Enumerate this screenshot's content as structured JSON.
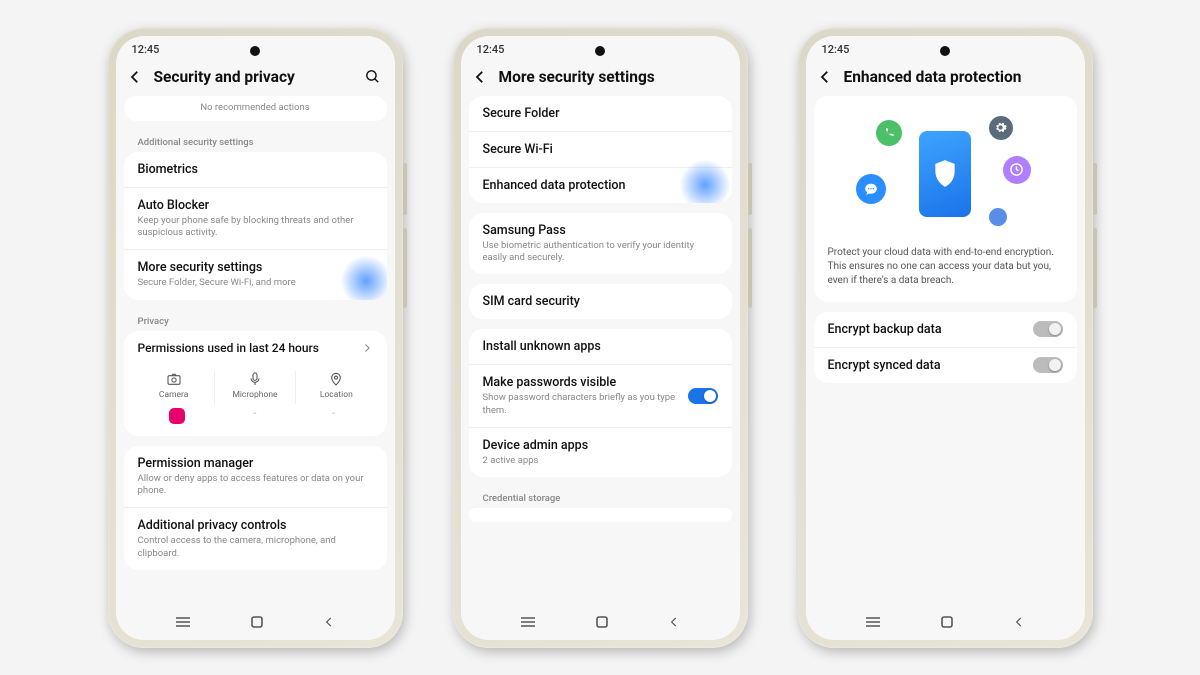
{
  "statusTime": "12:45",
  "screen1": {
    "title": "Security and privacy",
    "noActions": "No recommended actions",
    "section1": "Additional security settings",
    "biometrics": "Biometrics",
    "autoBlocker": {
      "label": "Auto Blocker",
      "sub": "Keep your phone safe by blocking threats and other suspicious activity."
    },
    "moreSecurity": {
      "label": "More security settings",
      "sub": "Secure Folder, Secure Wi-Fi, and more"
    },
    "section2": "Privacy",
    "permissions": "Permissions used in last 24 hours",
    "permCols": {
      "camera": "Camera",
      "mic": "Microphone",
      "location": "Location"
    },
    "permManager": {
      "label": "Permission manager",
      "sub": "Allow or deny apps to access features or data on your phone."
    },
    "addlPrivacy": {
      "label": "Additional privacy controls",
      "sub": "Control access to the camera, microphone, and clipboard."
    }
  },
  "screen2": {
    "title": "More security settings",
    "items": {
      "secureFolder": "Secure Folder",
      "secureWifi": "Secure Wi-Fi",
      "enhanced": "Enhanced data protection",
      "samsungPass": {
        "label": "Samsung Pass",
        "sub": "Use biometric authentication to verify your identity easily and securely."
      },
      "sim": "SIM card security",
      "installUnknown": "Install unknown apps",
      "makePwVisible": {
        "label": "Make passwords visible",
        "sub": "Show password characters briefly as you type them."
      },
      "deviceAdmin": {
        "label": "Device admin apps",
        "sub": "2 active apps"
      },
      "credStorage": "Credential storage"
    }
  },
  "screen3": {
    "title": "Enhanced data protection",
    "desc": "Protect your cloud data with end-to-end encryption. This ensures no one can access your data but you, even if there's a data breach.",
    "encryptBackup": "Encrypt backup data",
    "encryptSynced": "Encrypt synced data"
  }
}
